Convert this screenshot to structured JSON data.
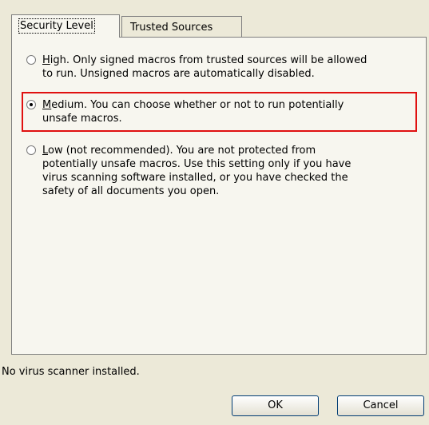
{
  "tabs": {
    "security_level": "Security Level",
    "trusted_sources": "Trusted Sources"
  },
  "options": {
    "high": {
      "line1_key": "H",
      "line1_rest": "igh. Only signed macros from trusted sources will be allowed",
      "line2": "to run. Unsigned macros are automatically disabled.",
      "selected": false
    },
    "medium": {
      "line1_key": "M",
      "line1_rest": "edium. You can choose whether or not to run potentially",
      "line2": "unsafe macros.",
      "selected": true
    },
    "low": {
      "line1_key": "L",
      "line1_rest": "ow (not recommended). You are not protected from",
      "line2": "potentially unsafe macros. Use this setting only if you have",
      "line3": "virus scanning software installed, or you have checked the",
      "line4": "safety of all documents you open.",
      "selected": false
    }
  },
  "status": {
    "text": "No virus scanner installed."
  },
  "buttons": {
    "ok": "OK",
    "cancel": "Cancel"
  },
  "colors": {
    "highlight": "#e01010"
  }
}
